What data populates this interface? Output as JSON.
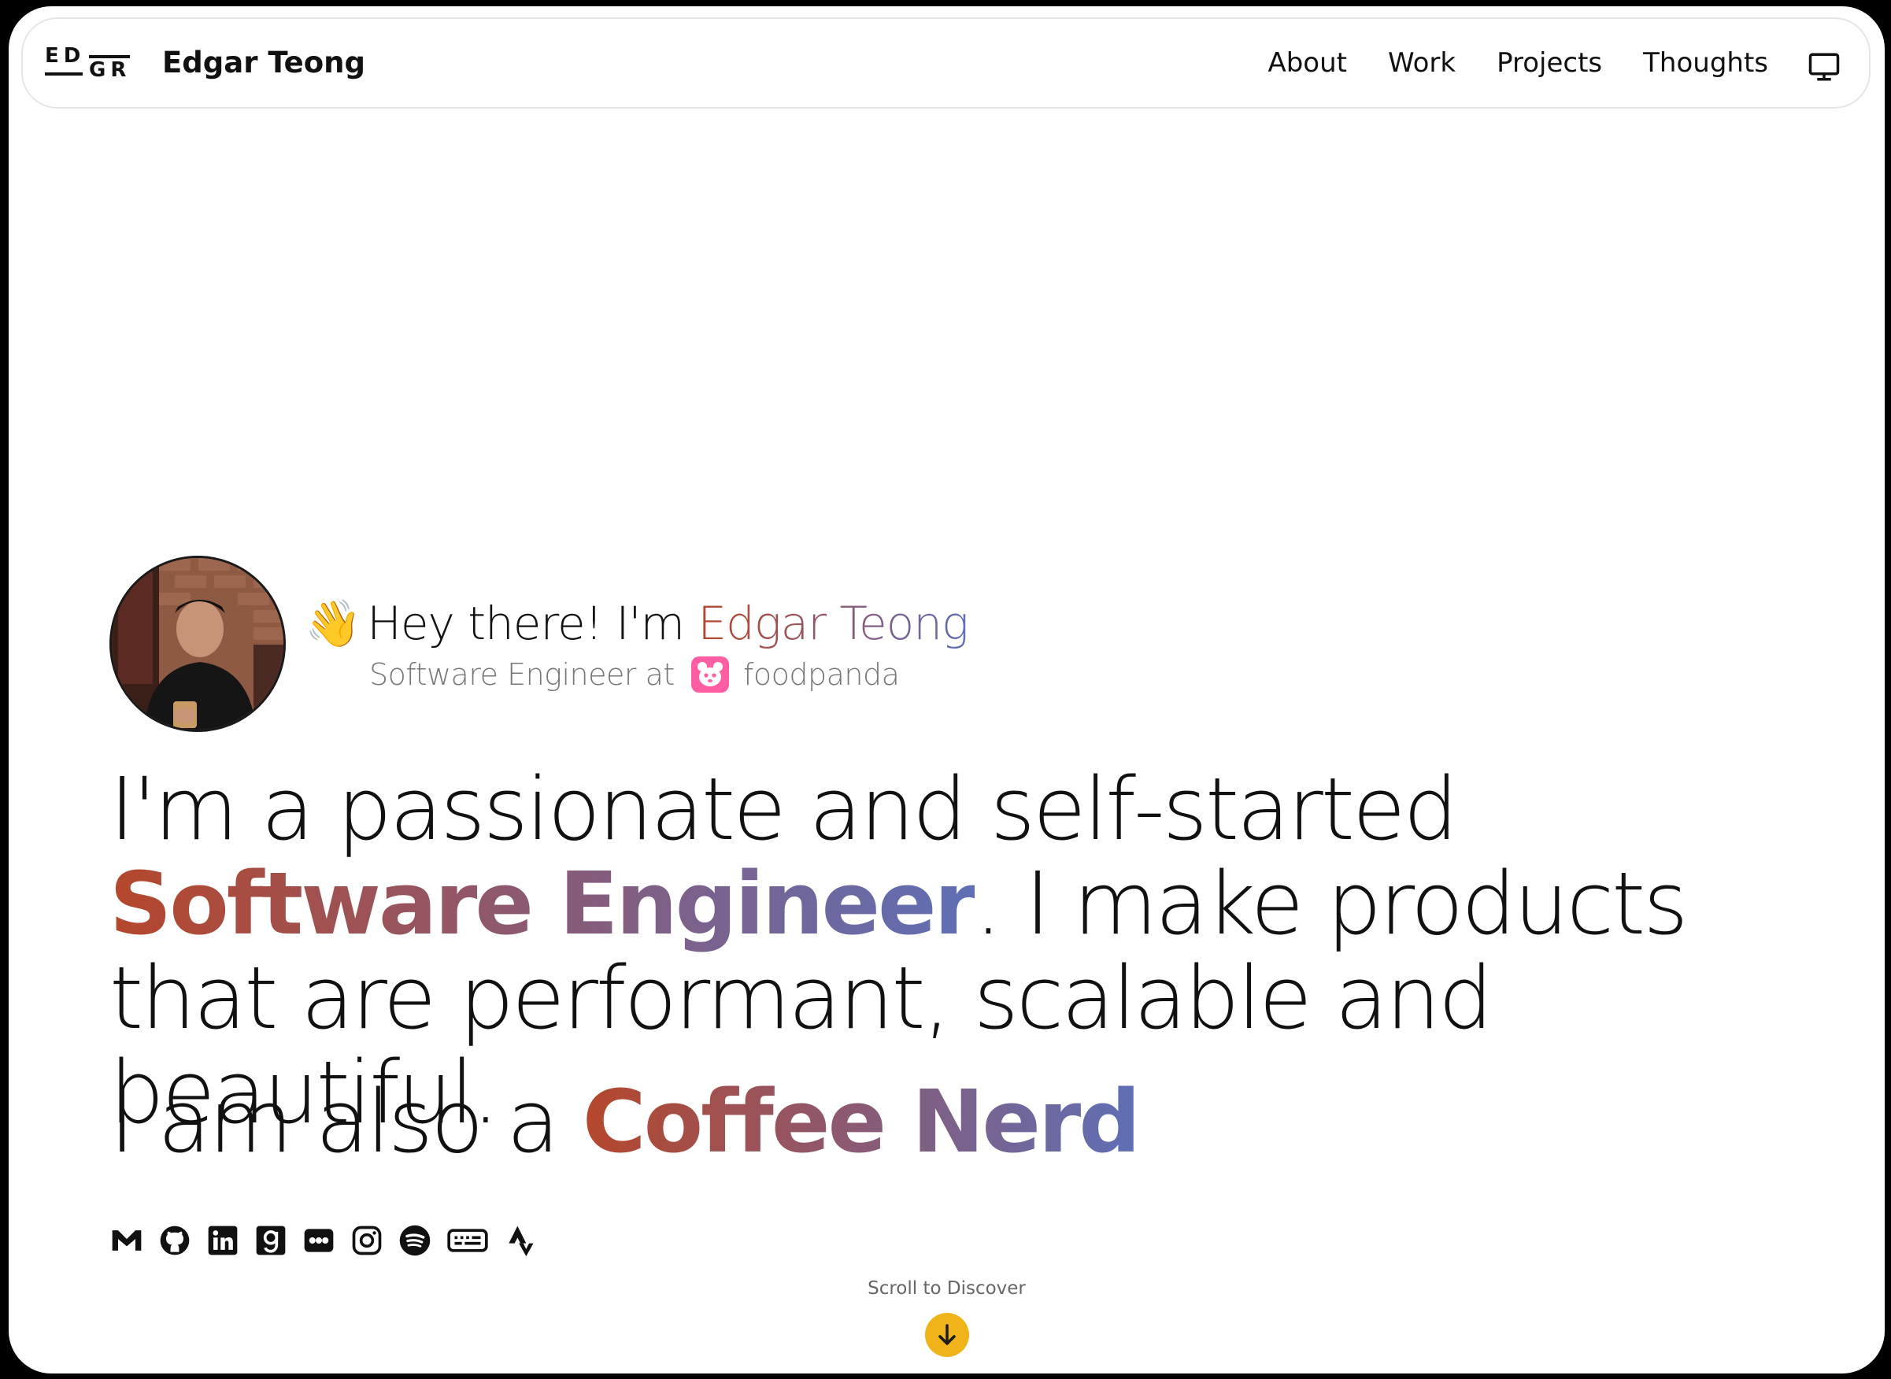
{
  "header": {
    "logo_line1": "ED",
    "logo_line2": "GR",
    "brand": "Edgar Teong",
    "nav": [
      "About",
      "Work",
      "Projects",
      "Thoughts"
    ],
    "theme_icon": "monitor-icon"
  },
  "hero": {
    "avatar": "profile-photo",
    "greeting_prefix": "Hey there! I'm",
    "wave_emoji": "👋",
    "name": "Edgar Teong",
    "subtitle_prefix": "Software Engineer at",
    "company": "foodpanda",
    "statement_part1": "I'm a passionate and self-started ",
    "statement_highlight": "Software Engineer",
    "statement_part2": ". I make products that are performant, scalable and beautiful.",
    "coffee_prefix": "I am also a ",
    "coffee_highlight": "Coffee Nerd"
  },
  "socials": [
    "gmail-icon",
    "github-icon",
    "linkedin-icon",
    "goodreads-icon",
    "flickr-icon",
    "instagram-icon",
    "spotify-icon",
    "monkeytype-icon",
    "strava-icon"
  ],
  "footer": {
    "scroll_text": "Scroll to Discover",
    "scroll_icon": "arrow-down-icon"
  },
  "colors": {
    "accent_start": "#b5472b",
    "accent_mid": "#8a5a75",
    "accent_end": "#5f6fb6",
    "scroll_button": "#f0b31a",
    "panda_pink": "#ff5fa2"
  }
}
